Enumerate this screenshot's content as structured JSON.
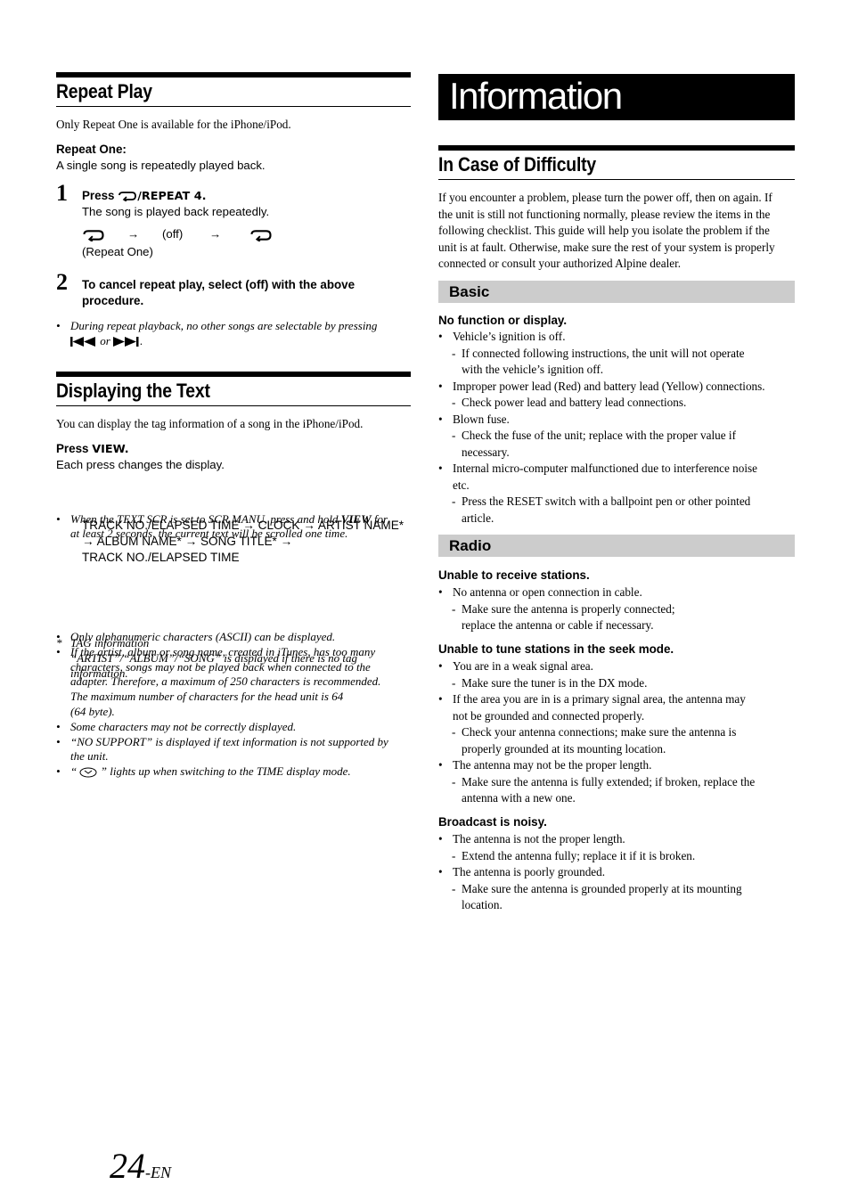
{
  "left": {
    "repeat_play": {
      "title": "Repeat Play",
      "intro": "Only Repeat One is available for the iPhone/iPod.",
      "subhead": "Repeat One:",
      "subtext": "A single song is repeatedly played back.",
      "step1": {
        "number": "1",
        "press": "Press ",
        "button": "/REPEAT 4.",
        "text": "The song is played back repeatedly.",
        "sequence": {
          "arrow": "→",
          "off": "(off)",
          "caption": "(Repeat One)"
        }
      },
      "step2": {
        "number": "2",
        "line1": "To cancel repeat play, select (off) with the above",
        "line2": "procedure."
      },
      "note": {
        "line1": "During repeat playback, no other songs are selectable by pressing",
        "or": " or ",
        "end": "."
      }
    },
    "displaying_text": {
      "title": "Displaying the Text",
      "intro": "You can display the tag information of a song in the iPhone/iPod.",
      "press_label": "Press ",
      "press_button": "VIEW.",
      "press_text": "Each press changes the display.",
      "note1_a": "When the TEXT SCR is set to SCR MANU, press and hold ",
      "note1_b": "VIEW",
      "note1_c": " for",
      "note1_line2": "at least 2 seconds, the current text will be scrolled one time.",
      "sequence": [
        "TRACK NO./ELAPSED TIME → CLOCK → ARTIST NAME*",
        "→ ALBUM NAME* → SONG TITLE* →",
        "TRACK NO./ELAPSED TIME"
      ],
      "footnote": [
        "TAG information",
        "“ARTIST”/“ALBUM”/“SONG” is displayed if there is no tag",
        "information."
      ],
      "notes": [
        [
          "Only alphanumeric characters (ASCII) can be displayed."
        ],
        [
          "If the artist, album or song name, created in iTunes, has too many",
          "characters, songs may not be played back when connected to the",
          "adapter. Therefore, a maximum of 250 characters is recommended.",
          "The maximum number of characters for the head unit is 64",
          "(64 byte)."
        ],
        [
          "Some characters may not be correctly displayed."
        ],
        [
          "“NO SUPPORT” is displayed if text information is not supported by",
          "the unit."
        ]
      ],
      "last_note_a": "“ ",
      "last_note_b": " ” lights up when switching to the TIME display mode."
    }
  },
  "right": {
    "banner": "Information",
    "difficulty": {
      "title": "In Case of Difficulty",
      "intro": [
        "If you encounter a problem, please turn the power off, then on again. If",
        "the unit is still not functioning normally, please review the items in the",
        "following checklist. This guide will help you isolate the problem if the",
        "unit is at fault. Otherwise, make sure the rest of your system is properly",
        "connected or consult your authorized Alpine dealer."
      ]
    },
    "basic": {
      "band": "Basic",
      "heading": "No function or display.",
      "items": [
        {
          "bullet": [
            "Vehicle’s ignition is off."
          ],
          "dash": [
            "If connected following instructions, the unit will not operate",
            "with the vehicle’s ignition off."
          ]
        },
        {
          "bullet": [
            "Improper power lead (Red) and battery lead (Yellow) connections."
          ],
          "dash": [
            "Check power lead and battery lead connections."
          ]
        },
        {
          "bullet": [
            "Blown fuse."
          ],
          "dash": [
            "Check the fuse of the unit; replace with the proper value if",
            "necessary."
          ]
        },
        {
          "bullet": [
            "Internal micro-computer malfunctioned due to interference noise",
            "etc."
          ],
          "dash": [
            "Press the RESET switch with a ballpoint pen or other pointed",
            "article."
          ]
        }
      ]
    },
    "radio": {
      "band": "Radio",
      "groups": [
        {
          "heading": "Unable to receive stations.",
          "items": [
            {
              "bullet": [
                "No antenna or open connection in cable."
              ],
              "dash": [
                "Make sure the antenna is properly connected;",
                "replace the antenna or cable if necessary."
              ]
            }
          ]
        },
        {
          "heading": "Unable to tune stations in the seek mode.",
          "items": [
            {
              "bullet": [
                "You are in a weak signal area."
              ],
              "dash": [
                "Make sure the tuner is in the DX mode."
              ]
            },
            {
              "bullet": [
                "If the area you are in is a primary signal area, the antenna may",
                "not be grounded and connected properly."
              ],
              "dash": [
                "Check your antenna connections; make sure the antenna is",
                "properly grounded at its mounting location."
              ]
            },
            {
              "bullet": [
                "The antenna may not be the proper length."
              ],
              "dash": [
                "Make sure the antenna is fully extended; if broken, replace the",
                "antenna with a new one."
              ]
            }
          ]
        },
        {
          "heading": "Broadcast is noisy.",
          "items": [
            {
              "bullet": [
                "The antenna is not the proper length."
              ],
              "dash": [
                "Extend the antenna fully; replace it if it is broken."
              ]
            },
            {
              "bullet": [
                "The antenna is poorly grounded."
              ],
              "dash": [
                "Make sure the antenna is grounded properly at its mounting",
                "location."
              ]
            }
          ]
        }
      ]
    }
  },
  "footer": {
    "page_number": "24",
    "suffix": "-EN"
  },
  "icons": {
    "repeat": "repeat-icon",
    "prev": "previous-track-icon",
    "next": "next-track-icon",
    "clock": "clock-icon"
  }
}
